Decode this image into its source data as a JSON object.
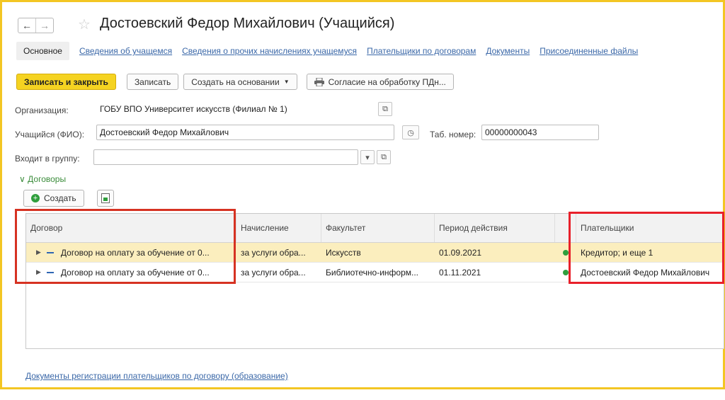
{
  "window": {
    "title": "Достоевский Федор Михайлович (Учащийся)",
    "nav_back": "←",
    "nav_forward": "→",
    "star": "☆"
  },
  "tabs": [
    {
      "label": "Основное",
      "active": true
    },
    {
      "label": "Сведения об учащемся"
    },
    {
      "label": "Сведения о прочих начислениях учащемуся"
    },
    {
      "label": "Плательщики по договорам"
    },
    {
      "label": "Документы"
    },
    {
      "label": "Присоединенные файлы"
    }
  ],
  "toolbar": {
    "save_close": "Записать и закрыть",
    "save": "Записать",
    "create_based": "Создать на основании",
    "consent": "Согласие на обработку ПДн..."
  },
  "form": {
    "org_label": "Организация:",
    "org_value": "ГОБУ ВПО Университет искусств (Филиал № 1)",
    "student_label": "Учащийся (ФИО):",
    "student_value": "Достоевский Федор Михайлович",
    "tab_label": "Таб. номер:",
    "tab_value": "00000000043",
    "group_label": "Входит в группу:",
    "group_value": ""
  },
  "contracts": {
    "section_title": "Договоры",
    "create_button": "Создать",
    "columns": [
      "Договор",
      "Начисление",
      "Факультет",
      "Период действия",
      "",
      "Плательщики"
    ],
    "rows": [
      {
        "contract": "Договор на оплату за обучение от 0...",
        "accrual": "за услуги обра...",
        "faculty": "Искусств",
        "period": "01.09.2021",
        "payers": "Кредитор; и еще 1"
      },
      {
        "contract": "Договор на оплату за обучение от 0...",
        "accrual": "за услуги обра...",
        "faculty": "Библиотечно-информ...",
        "period": "01.11.2021",
        "payers": "Достоевский Федор Михайлович"
      }
    ]
  },
  "bottom_link": "Документы регистрации плательщиков по договору (образование)",
  "colors": {
    "primary_button": "#f5d321",
    "link": "#3b68a8",
    "highlight_border": "#d63222",
    "selected_row": "#fbeebe"
  }
}
